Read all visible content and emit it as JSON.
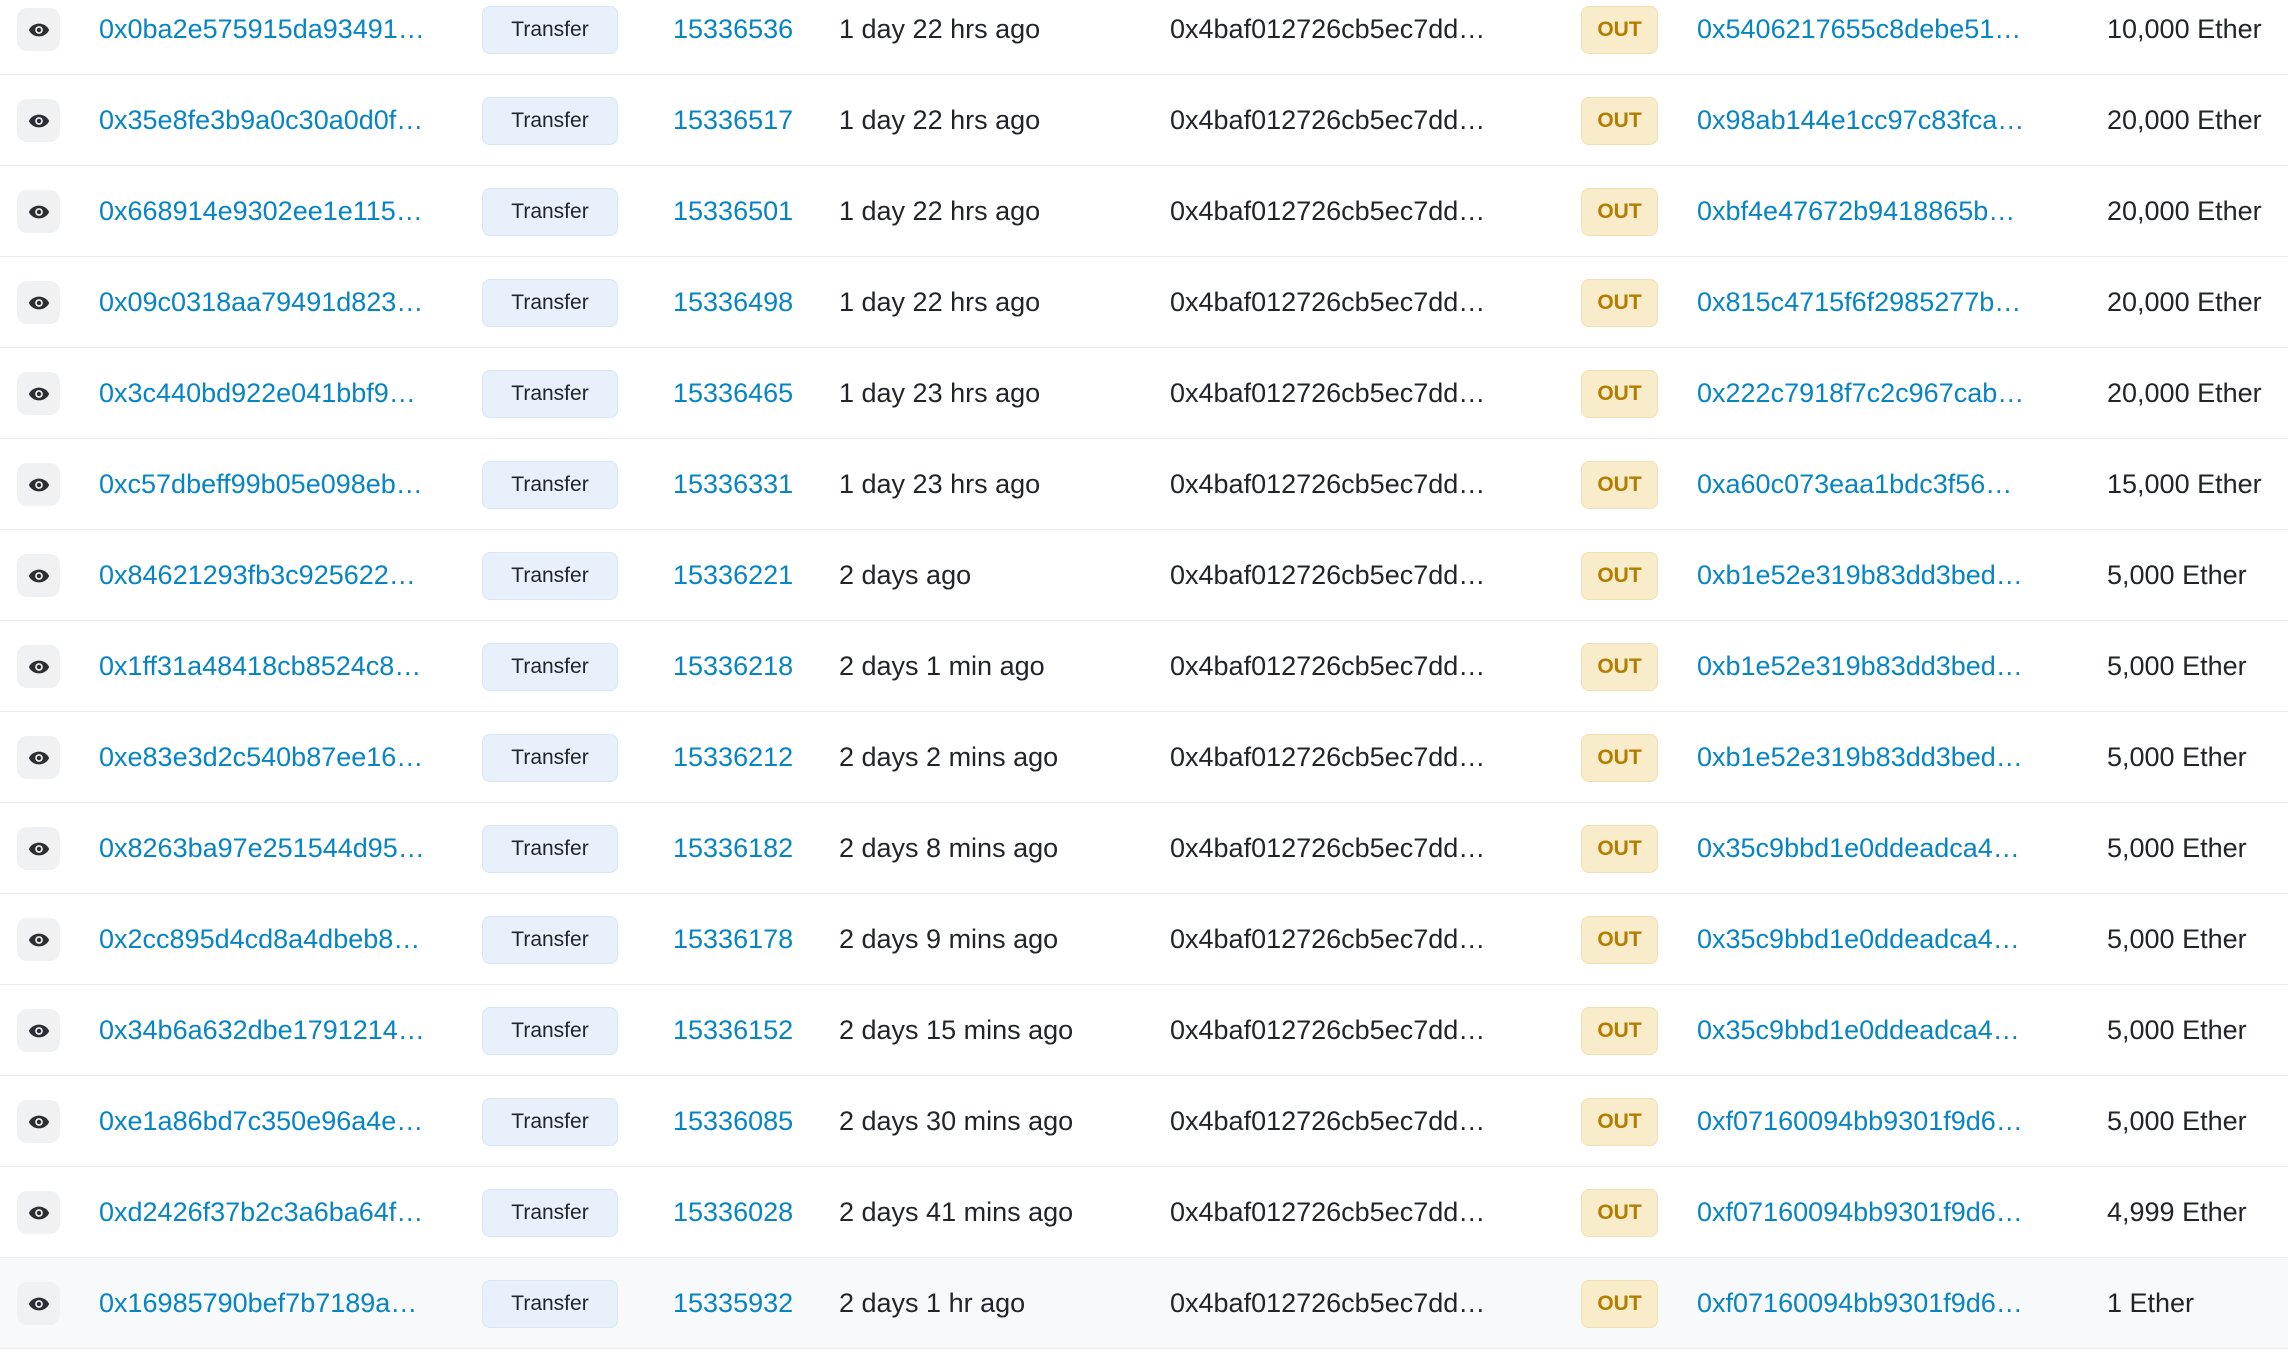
{
  "icons": {
    "view": "eye-icon"
  },
  "colors": {
    "link": "#0784c3",
    "text": "#212529",
    "out_badge_bg": "#f8eccb",
    "out_badge_text": "#b47d00",
    "method_badge_bg": "#e8f1fb"
  },
  "transactions": [
    {
      "hash": "0x0ba2e575915da93491…",
      "method": "Transfer",
      "block": "15336536",
      "age": "1 day 22 hrs ago",
      "from": "0x4baf012726cb5ec7dd…",
      "direction": "OUT",
      "to": "0x5406217655c8debe51…",
      "value": "10,000 Ether"
    },
    {
      "hash": "0x35e8fe3b9a0c30a0d0f…",
      "method": "Transfer",
      "block": "15336517",
      "age": "1 day 22 hrs ago",
      "from": "0x4baf012726cb5ec7dd…",
      "direction": "OUT",
      "to": "0x98ab144e1cc97c83fca…",
      "value": "20,000 Ether"
    },
    {
      "hash": "0x668914e9302ee1e115…",
      "method": "Transfer",
      "block": "15336501",
      "age": "1 day 22 hrs ago",
      "from": "0x4baf012726cb5ec7dd…",
      "direction": "OUT",
      "to": "0xbf4e47672b9418865b…",
      "value": "20,000 Ether"
    },
    {
      "hash": "0x09c0318aa79491d823…",
      "method": "Transfer",
      "block": "15336498",
      "age": "1 day 22 hrs ago",
      "from": "0x4baf012726cb5ec7dd…",
      "direction": "OUT",
      "to": "0x815c4715f6f2985277b…",
      "value": "20,000 Ether"
    },
    {
      "hash": "0x3c440bd922e041bbf9…",
      "method": "Transfer",
      "block": "15336465",
      "age": "1 day 23 hrs ago",
      "from": "0x4baf012726cb5ec7dd…",
      "direction": "OUT",
      "to": "0x222c7918f7c2c967cab…",
      "value": "20,000 Ether"
    },
    {
      "hash": "0xc57dbeff99b05e098eb…",
      "method": "Transfer",
      "block": "15336331",
      "age": "1 day 23 hrs ago",
      "from": "0x4baf012726cb5ec7dd…",
      "direction": "OUT",
      "to": "0xa60c073eaa1bdc3f56…",
      "value": "15,000 Ether"
    },
    {
      "hash": "0x84621293fb3c925622…",
      "method": "Transfer",
      "block": "15336221",
      "age": "2 days ago",
      "from": "0x4baf012726cb5ec7dd…",
      "direction": "OUT",
      "to": "0xb1e52e319b83dd3bed…",
      "value": "5,000 Ether"
    },
    {
      "hash": "0x1ff31a48418cb8524c8…",
      "method": "Transfer",
      "block": "15336218",
      "age": "2 days 1 min ago",
      "from": "0x4baf012726cb5ec7dd…",
      "direction": "OUT",
      "to": "0xb1e52e319b83dd3bed…",
      "value": "5,000 Ether"
    },
    {
      "hash": "0xe83e3d2c540b87ee16…",
      "method": "Transfer",
      "block": "15336212",
      "age": "2 days 2 mins ago",
      "from": "0x4baf012726cb5ec7dd…",
      "direction": "OUT",
      "to": "0xb1e52e319b83dd3bed…",
      "value": "5,000 Ether"
    },
    {
      "hash": "0x8263ba97e251544d95…",
      "method": "Transfer",
      "block": "15336182",
      "age": "2 days 8 mins ago",
      "from": "0x4baf012726cb5ec7dd…",
      "direction": "OUT",
      "to": "0x35c9bbd1e0ddeadca4…",
      "value": "5,000 Ether"
    },
    {
      "hash": "0x2cc895d4cd8a4dbeb8…",
      "method": "Transfer",
      "block": "15336178",
      "age": "2 days 9 mins ago",
      "from": "0x4baf012726cb5ec7dd…",
      "direction": "OUT",
      "to": "0x35c9bbd1e0ddeadca4…",
      "value": "5,000 Ether"
    },
    {
      "hash": "0x34b6a632dbe1791214…",
      "method": "Transfer",
      "block": "15336152",
      "age": "2 days 15 mins ago",
      "from": "0x4baf012726cb5ec7dd…",
      "direction": "OUT",
      "to": "0x35c9bbd1e0ddeadca4…",
      "value": "5,000 Ether"
    },
    {
      "hash": "0xe1a86bd7c350e96a4e…",
      "method": "Transfer",
      "block": "15336085",
      "age": "2 days 30 mins ago",
      "from": "0x4baf012726cb5ec7dd…",
      "direction": "OUT",
      "to": "0xf07160094bb9301f9d6…",
      "value": "5,000 Ether"
    },
    {
      "hash": "0xd2426f37b2c3a6ba64f…",
      "method": "Transfer",
      "block": "15336028",
      "age": "2 days 41 mins ago",
      "from": "0x4baf012726cb5ec7dd…",
      "direction": "OUT",
      "to": "0xf07160094bb9301f9d6…",
      "value": "4,999 Ether"
    },
    {
      "hash": "0x16985790bef7b7189a…",
      "method": "Transfer",
      "block": "15335932",
      "age": "2 days 1 hr ago",
      "from": "0x4baf012726cb5ec7dd…",
      "direction": "OUT",
      "to": "0xf07160094bb9301f9d6…",
      "value": "1 Ether"
    }
  ]
}
